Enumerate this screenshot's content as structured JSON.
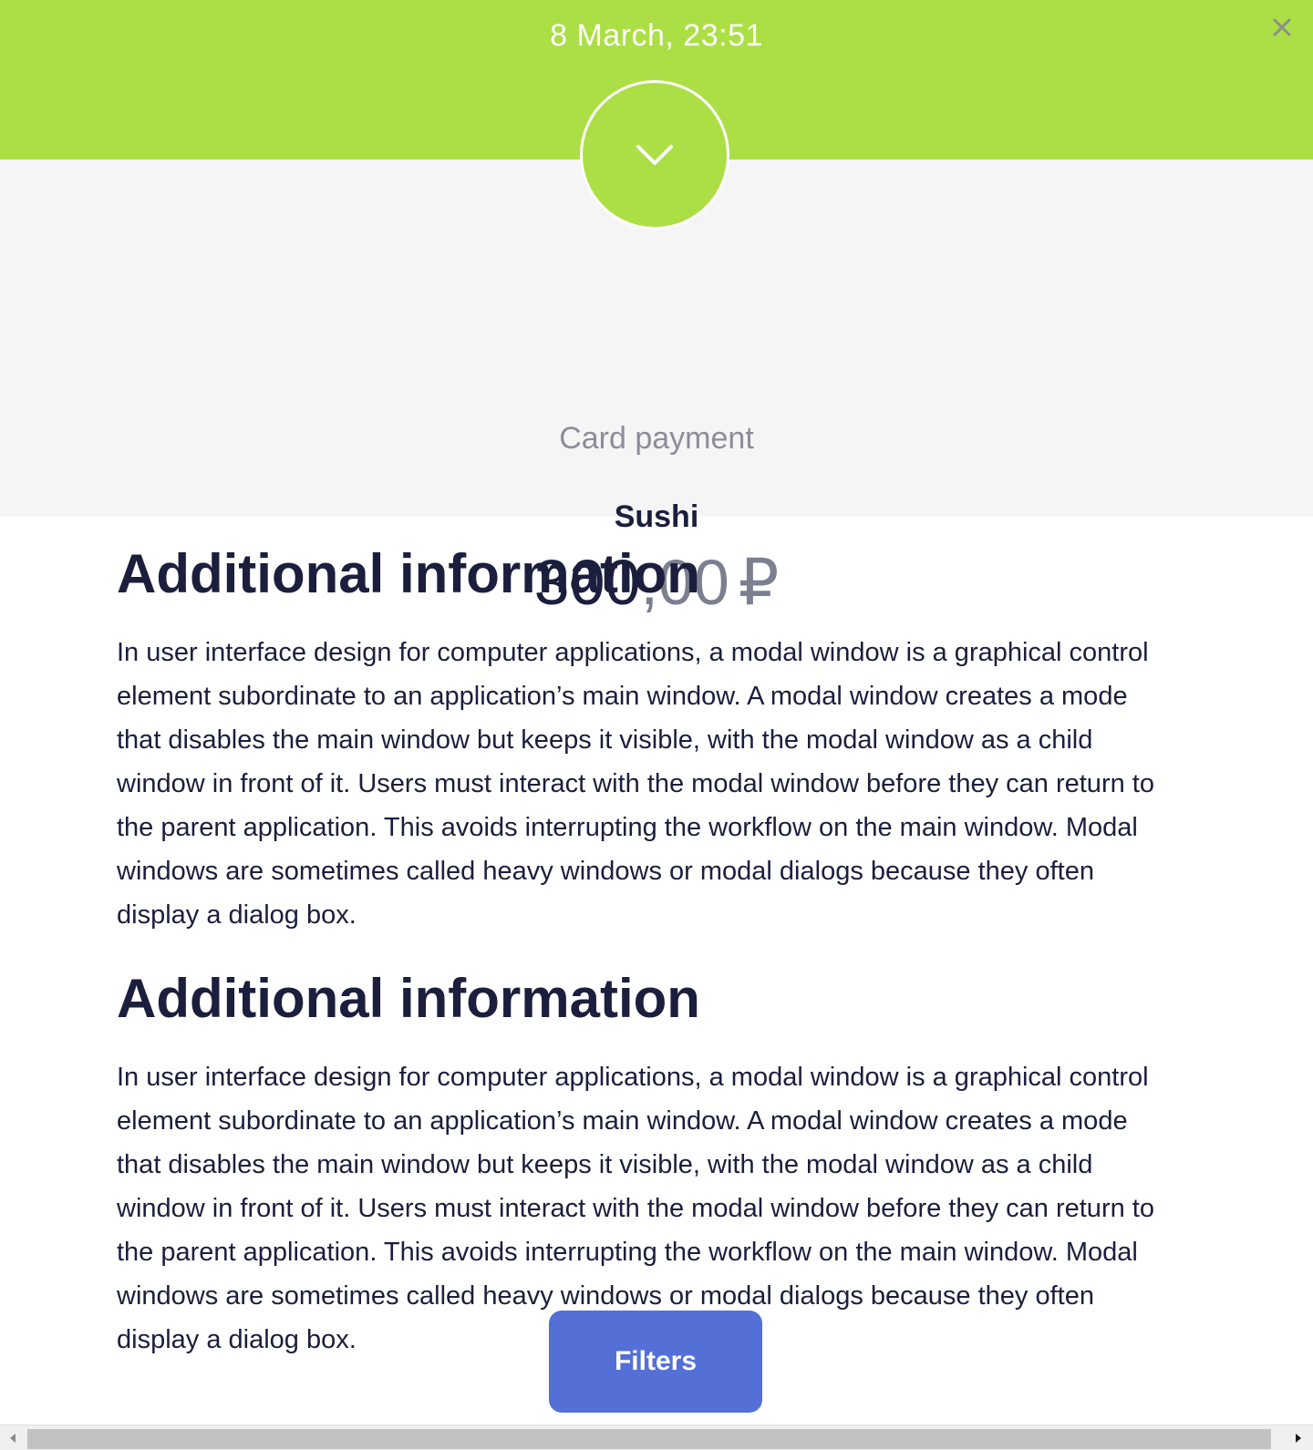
{
  "header": {
    "datetime": "8 March, 23:51",
    "close_icon": "close-icon",
    "accent_color": "#abdf45"
  },
  "summary": {
    "status_icon": "chevron-down-icon",
    "payment_type": "Card payment",
    "merchant": "Sushi",
    "amount_integer": "300",
    "amount_fraction": ",00",
    "amount_currency": "₽"
  },
  "sections": [
    {
      "heading": "Additional information",
      "body": "In user interface design for computer applications, a modal window is a graphical control element subordinate to an application’s main window. A modal window creates a mode that disables the main window but keeps it visible, with the modal window as a child window in front of it. Users must interact with the modal window before they can return to the parent application. This avoids interrupting the workflow on the main window. Modal windows are sometimes called heavy windows or modal dialogs because they often display a dialog box."
    },
    {
      "heading": "Additional information",
      "body": "In user interface design for computer applications, a modal window is a graphical control element subordinate to an application’s main window. A modal window creates a mode that disables the main window but keeps it visible, with the modal window as a child window in front of it. Users must interact with the modal window before they can return to the parent application. This avoids interrupting the workflow on the main window. Modal windows are sometimes called heavy windows or modal dialogs because they often display a dialog box."
    }
  ],
  "filters": {
    "label": "Filters",
    "color": "#5470d6"
  }
}
